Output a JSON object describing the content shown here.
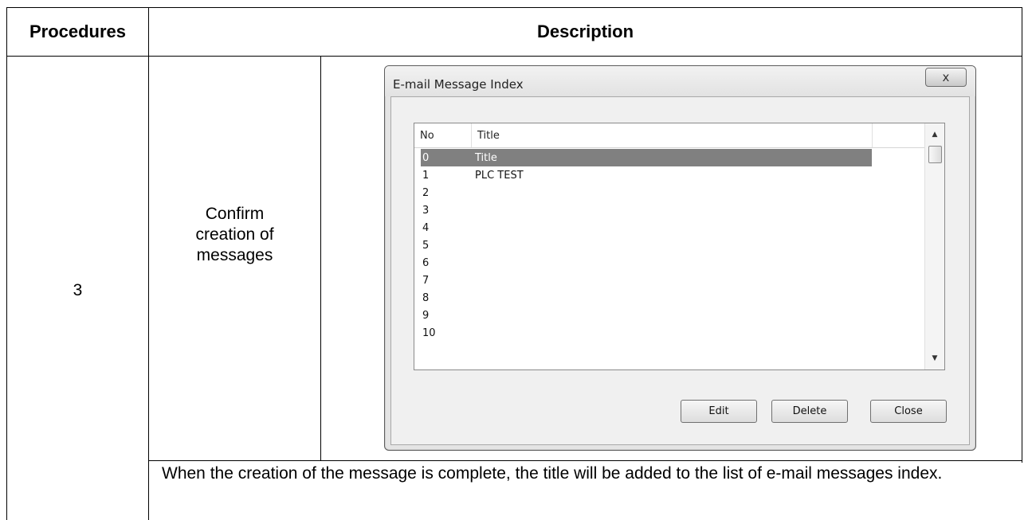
{
  "table": {
    "header_procedures": "Procedures",
    "header_description": "Description",
    "step_number": "3",
    "step_action_lines": [
      "Confirm",
      "creation of",
      "messages"
    ],
    "note": "When the creation of the message is complete, the title will be added to the list of e-mail messages index."
  },
  "dialog": {
    "title": "E-mail Message Index",
    "close_glyph": "x",
    "columns": [
      "No",
      "Title"
    ],
    "rows": [
      {
        "no": "0",
        "title": "Title",
        "selected": true
      },
      {
        "no": "1",
        "title": "PLC TEST",
        "selected": false
      },
      {
        "no": "2",
        "title": "",
        "selected": false
      },
      {
        "no": "3",
        "title": "",
        "selected": false
      },
      {
        "no": "4",
        "title": "",
        "selected": false
      },
      {
        "no": "5",
        "title": "",
        "selected": false
      },
      {
        "no": "6",
        "title": "",
        "selected": false
      },
      {
        "no": "7",
        "title": "",
        "selected": false
      },
      {
        "no": "8",
        "title": "",
        "selected": false
      },
      {
        "no": "9",
        "title": "",
        "selected": false
      },
      {
        "no": "10",
        "title": "",
        "selected": false
      }
    ],
    "buttons": {
      "edit": "Edit",
      "delete": "Delete",
      "close": "Close"
    },
    "scroll_up_glyph": "▲",
    "scroll_down_glyph": "▼",
    "selection_color": "#808080"
  }
}
